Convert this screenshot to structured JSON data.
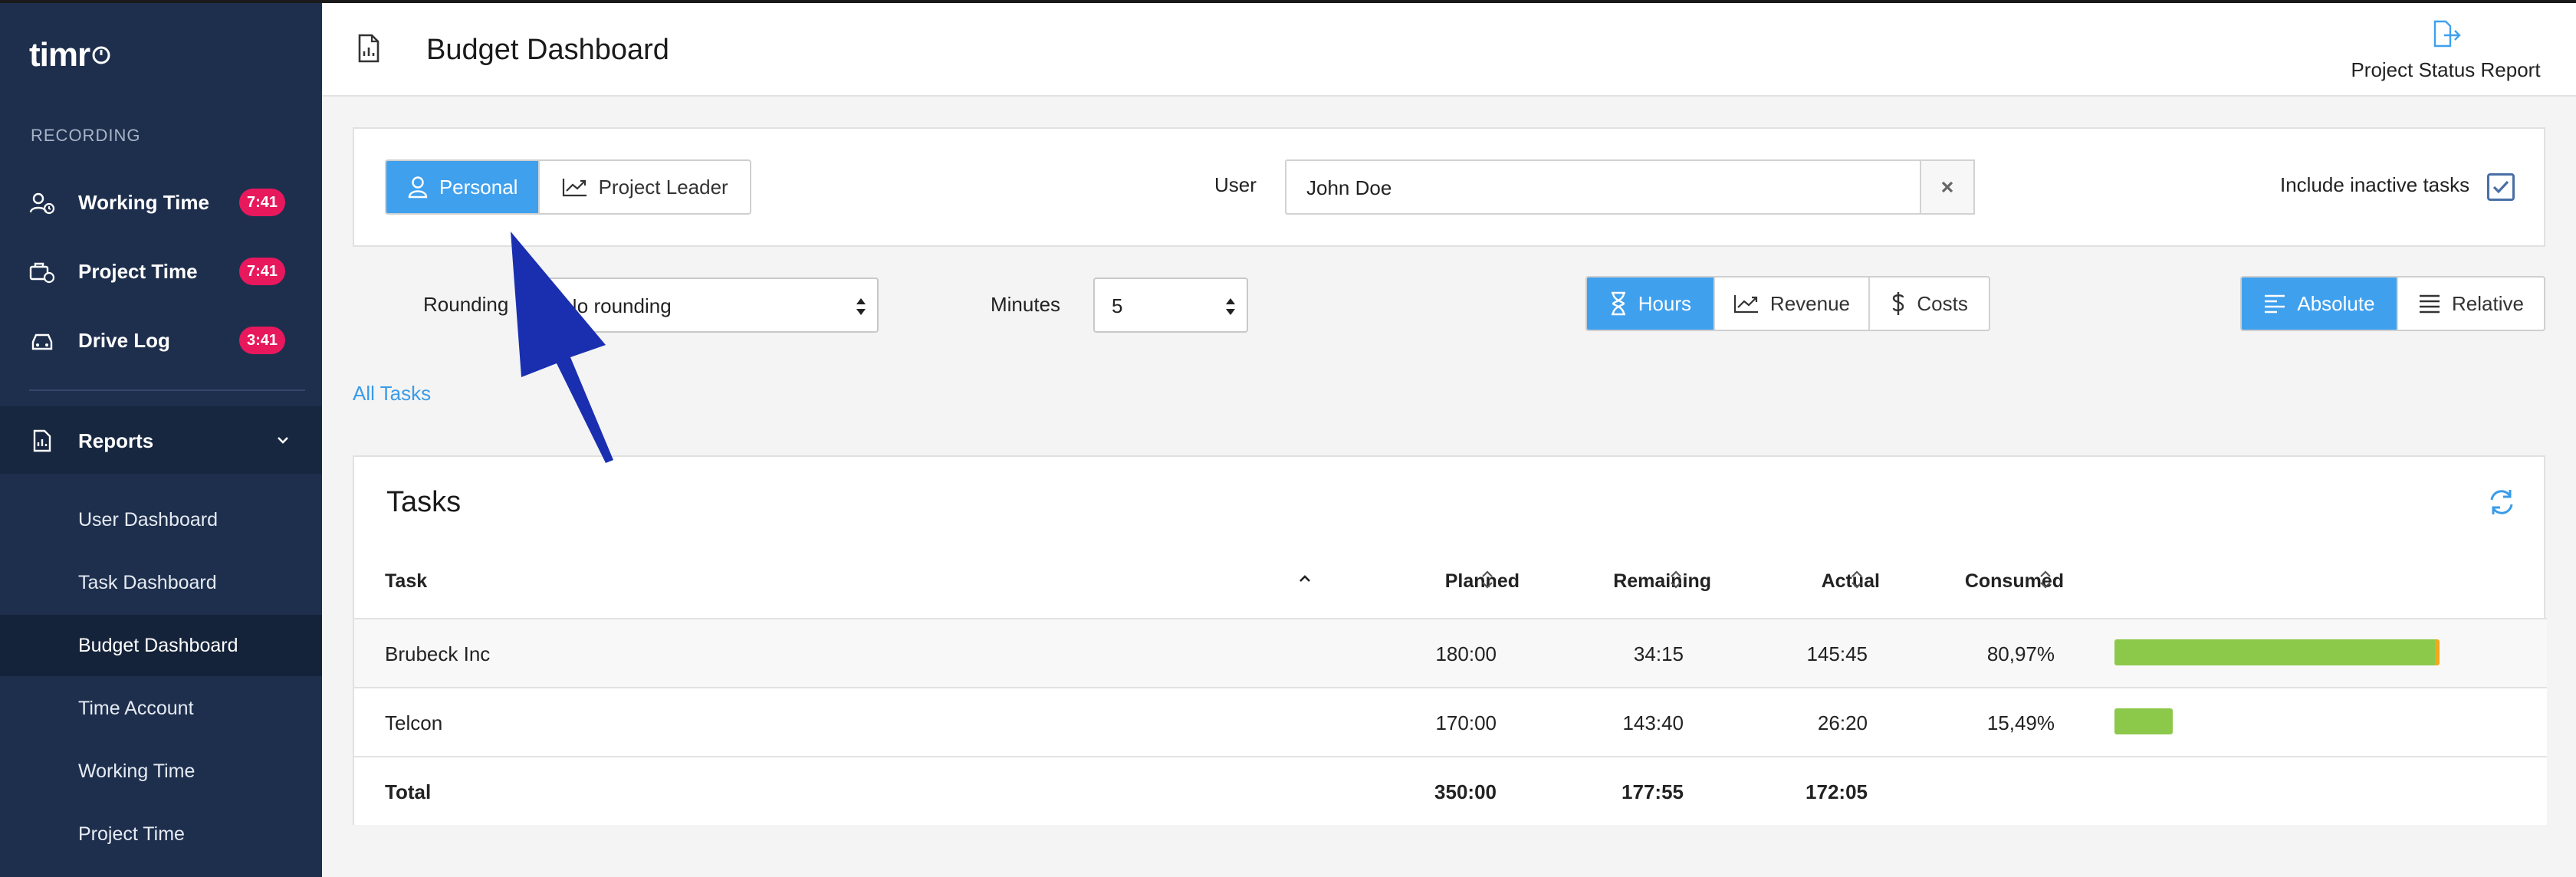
{
  "sidebar": {
    "logo": "timr",
    "section_label": "RECORDING",
    "items": [
      {
        "label": "Working Time",
        "badge": "7:41",
        "icon": "user-clock-icon"
      },
      {
        "label": "Project Time",
        "badge": "7:41",
        "icon": "briefcase-clock-icon"
      },
      {
        "label": "Drive Log",
        "badge": "3:41",
        "icon": "car-icon"
      }
    ],
    "reports_label": "Reports",
    "report_items": [
      {
        "label": "User Dashboard"
      },
      {
        "label": "Task Dashboard"
      },
      {
        "label": "Budget Dashboard",
        "active": true
      },
      {
        "label": "Time Account"
      },
      {
        "label": "Working Time"
      },
      {
        "label": "Project Time"
      }
    ]
  },
  "header": {
    "title": "Budget Dashboard",
    "status_report_label": "Project Status Report"
  },
  "filters": {
    "view_options": [
      "Personal",
      "Project Leader"
    ],
    "view_selected": "Personal",
    "user_label": "User",
    "user_value": "John Doe",
    "include_inactive_label": "Include inactive tasks",
    "include_inactive_checked": true,
    "rounding_label": "Rounding",
    "rounding_value": "No rounding",
    "minutes_label": "Minutes",
    "minutes_value": "5",
    "measure_options": [
      "Hours",
      "Revenue",
      "Costs"
    ],
    "measure_selected": "Hours",
    "mode_options": [
      "Absolute",
      "Relative"
    ],
    "mode_selected": "Absolute"
  },
  "breadcrumb": "All Tasks",
  "tasks": {
    "title": "Tasks",
    "columns": [
      "Task",
      "Planned",
      "Remaining",
      "Actual",
      "Consumed"
    ],
    "rows": [
      {
        "task": "Brubeck Inc",
        "planned": "180:00",
        "remaining": "34:15",
        "actual": "145:45",
        "consumed": "80,97%",
        "consumed_pct": 80.97
      },
      {
        "task": "Telcon",
        "planned": "170:00",
        "remaining": "143:40",
        "actual": "26:20",
        "consumed": "15,49%",
        "consumed_pct": 15.49
      }
    ],
    "total": {
      "label": "Total",
      "planned": "350:00",
      "remaining": "177:55",
      "actual": "172:05"
    }
  },
  "colors": {
    "sidebar_bg": "#1e2f4d",
    "accent": "#3fa0ee",
    "badge": "#e8185d",
    "bar": "#8cc94a",
    "bar_overflow": "#f0a81c",
    "annotation_arrow": "#1a2fb0"
  }
}
